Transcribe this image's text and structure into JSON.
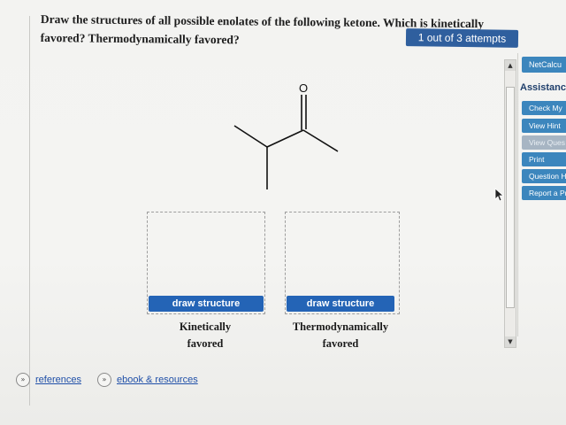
{
  "question": {
    "line1": "Draw the structures of all possible enolates of the following ketone. Which is kinetically",
    "line2": "favored? Thermodynamically favored?"
  },
  "attempts_badge": "1 out of 3 attempts",
  "sidebar": {
    "netcalc_label": "NetCalcu",
    "assistance_title": "Assistance",
    "buttons": [
      {
        "label": "Check My"
      },
      {
        "label": "View Hint"
      },
      {
        "label": "View Ques"
      },
      {
        "label": "Print"
      },
      {
        "label": "Question H"
      },
      {
        "label": "Report a Pr"
      }
    ]
  },
  "molecule": {
    "atom_label": "O"
  },
  "answers": [
    {
      "button_label": "draw structure",
      "caption_line1": "Kinetically",
      "caption_line2": "favored"
    },
    {
      "button_label": "draw structure",
      "caption_line1": "Thermodynamically",
      "caption_line2": "favored"
    }
  ],
  "footer": {
    "references_label": "references",
    "ebook_label": "ebook & resources"
  },
  "colors": {
    "primary_button": "#2464b6",
    "sidebar_button": "#3c86bd",
    "link": "#1f4fa8"
  }
}
